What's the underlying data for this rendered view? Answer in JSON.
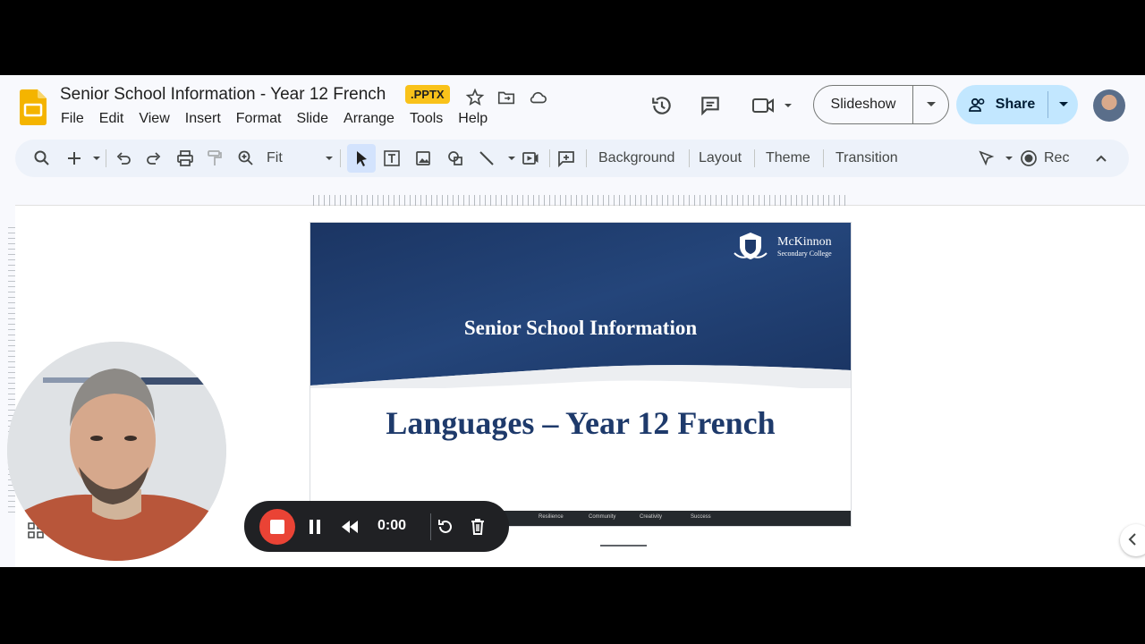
{
  "document": {
    "title": "Senior School Information - Year 12 French",
    "format_badge": ".PPTX"
  },
  "menu": [
    "File",
    "Edit",
    "View",
    "Insert",
    "Format",
    "Slide",
    "Arrange",
    "Tools",
    "Help"
  ],
  "header_buttons": {
    "slideshow": "Slideshow",
    "share": "Share"
  },
  "toolbar": {
    "zoom": "Fit",
    "background": "Background",
    "layout": "Layout",
    "theme": "Theme",
    "transition": "Transition",
    "rec": "Rec"
  },
  "slide": {
    "school_name": "McKinnon",
    "school_subtitle": "Secondary College",
    "heading": "Senior School Information",
    "title": "Languages – Year 12 French",
    "footer_values": [
      "Resilience",
      "Community",
      "Creativity",
      "Success"
    ]
  },
  "recorder": {
    "time": "0:00"
  },
  "colors": {
    "slide_banner": "#1e3a6b",
    "share_button": "#c2e7ff",
    "record_stop": "#ea4335",
    "badge": "#f9c21a"
  }
}
